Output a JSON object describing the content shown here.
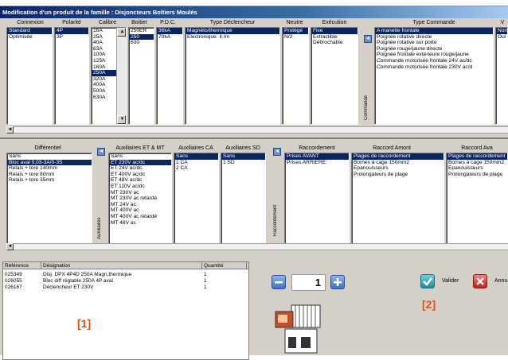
{
  "title": "Modification d'un produit de la famille : Disjoncteurs Boîtiers Moulés",
  "section1": {
    "columns": [
      "Connexion",
      "Polarité",
      "Calibre",
      "Boitier",
      "P.D.C.",
      "Type Déclencheur",
      "Neutre",
      "Exécution",
      "Type Commande",
      "V"
    ],
    "connexion": [
      "Standard",
      "Optimisée"
    ],
    "polarite": [
      "4P",
      "3P"
    ],
    "calibre": [
      "16A",
      "25A",
      "40A",
      "63A",
      "100A",
      "125A",
      "160A",
      "250A",
      "320A",
      "400A",
      "500A",
      "630A"
    ],
    "boitier": [
      "250ER",
      "250",
      "630"
    ],
    "pdc": [
      "36kA",
      "70kA"
    ],
    "declencheur": [
      "Magnéto/thermique",
      "Electronique: Ir,Im"
    ],
    "neutre": [
      "Protégé",
      "N/2"
    ],
    "execution": [
      "Fixe",
      "Extractible",
      "Débrochable"
    ],
    "commande": [
      "A manette frontale",
      "Poignée rotative directe",
      "Poignée rotative sur porte",
      "Poignée rouge/jaune directe",
      "Poignée frontale extérieure rouge/jaune",
      "Commande motorisée frontale 24V ac/dc",
      "Commande motorisée frontale 230V ac/d"
    ],
    "v": [
      "Non",
      "Oui"
    ],
    "side_label": "Commande"
  },
  "section2": {
    "columns": [
      "Différentiel",
      "Auxiliaires ET & MT",
      "Auxiliaires CA",
      "Auxiliaires SD",
      "Raccordement",
      "Raccord Amont",
      "Raccord Ava"
    ],
    "differentiel": [
      "Sans",
      "Bloc aval 0,03-3A/0-3S",
      "Relais + tore 140mm",
      "Relais + tore 80mm",
      "Relais + tore 35mm"
    ],
    "aux_et_mt": [
      "Sans",
      "ET 230V ac/dc",
      "ET 24V ac/dc",
      "ET 400V ac/dc",
      "ET 48V ac/dc",
      "ET 110V ac/dc",
      "MT 230V ac",
      "MT 230V ac retardé",
      "MT 24V ac",
      "MT 400V ac",
      "MT 400V ac retardé",
      "MT 48V ac"
    ],
    "aux_ca": [
      "Sans",
      "1 CA",
      "2 CA"
    ],
    "aux_sd": [
      "Sans",
      "1 SD"
    ],
    "raccordement": [
      "Prises AVANT",
      "Prises ARRIERE"
    ],
    "raccord_amont": [
      "Plages de raccordement",
      "Bornes à cage 150mm2",
      "Epanouisseurs",
      "Prolongateurs de plage"
    ],
    "raccord_aval": [
      "Plages de raccordement",
      "Bornes à cage 150mm2",
      "Epanouisseurs",
      "Prolongateurs de plage"
    ],
    "side_label_aux": "Auxiliaires",
    "side_label_racc": "Raccordement"
  },
  "table": {
    "headers": [
      "Référence",
      "Désignation",
      "Quantité"
    ],
    "rows": [
      {
        "ref": "025349",
        "designation": "Disj. DPX 4P4D 250A Magn.thermique",
        "qty": "1"
      },
      {
        "ref": "026055",
        "designation": "Bloc diff réglable 250A 4P aval",
        "qty": "1"
      },
      {
        "ref": "026167",
        "designation": "Déclencheur ET 230V",
        "qty": "1"
      }
    ]
  },
  "quantity": "1",
  "valider_label": "Valider",
  "annuler_label": "Annu",
  "marker1": "[1]",
  "marker2": "[2]"
}
